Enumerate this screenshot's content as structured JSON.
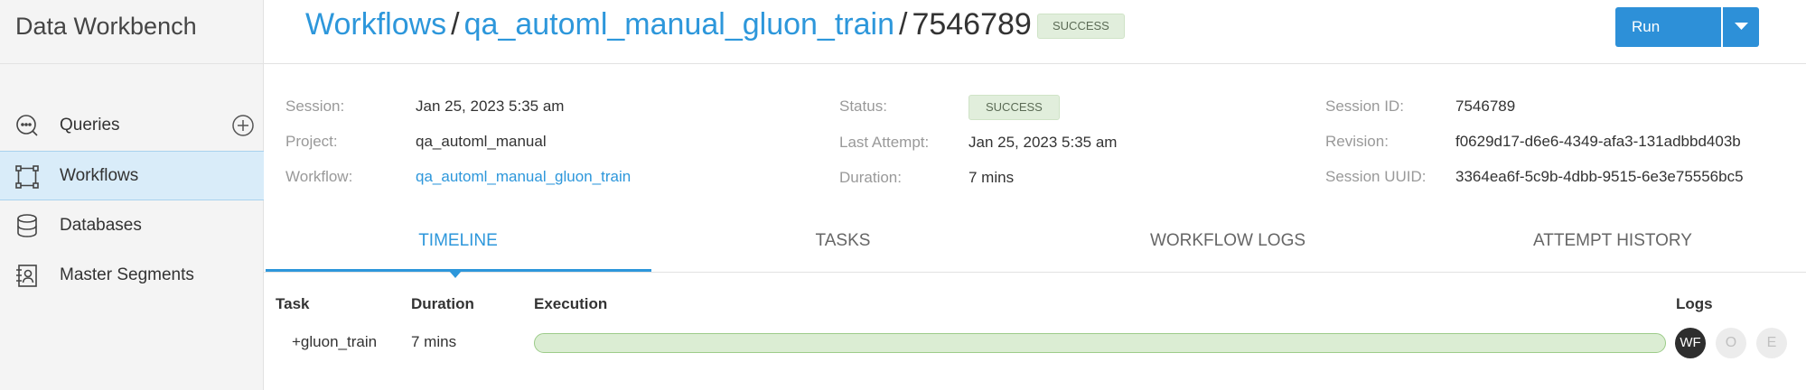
{
  "app": {
    "title": "Data Workbench"
  },
  "sidebar": {
    "items": [
      {
        "label": "Queries",
        "icon": "chat-icon",
        "active": false
      },
      {
        "label": "Workflows",
        "icon": "workflow-icon",
        "active": true
      },
      {
        "label": "Databases",
        "icon": "database-icon",
        "active": false
      },
      {
        "label": "Master Segments",
        "icon": "segment-icon",
        "active": false
      }
    ]
  },
  "header": {
    "breadcrumb": [
      "Workflows",
      "qa_automl_manual_gluon_train",
      "7546789"
    ],
    "separator": "/",
    "badge": "SUCCESS",
    "run_label": "Run"
  },
  "details": {
    "session_label": "Session:",
    "session_value": "Jan 25, 2023 5:35 am",
    "project_label": "Project:",
    "project_value": "qa_automl_manual",
    "workflow_label": "Workflow:",
    "workflow_value": "qa_automl_manual_gluon_train",
    "status_label": "Status:",
    "status_value": "SUCCESS",
    "last_attempt_label": "Last Attempt:",
    "last_attempt_value": "Jan 25, 2023 5:35 am",
    "duration_label": "Duration:",
    "duration_value": "7 mins",
    "session_id_label": "Session ID:",
    "session_id_value": "7546789",
    "revision_label": "Revision:",
    "revision_value": "f0629d17-d6e6-4349-afa3-131adbbd403b",
    "session_uuid_label": "Session UUID:",
    "session_uuid_value": "3364ea6f-5c9b-4dbb-9515-6e3e75556bc5"
  },
  "tabs": [
    {
      "label": "TIMELINE",
      "active": true
    },
    {
      "label": "TASKS",
      "active": false
    },
    {
      "label": "WORKFLOW LOGS",
      "active": false
    },
    {
      "label": "ATTEMPT HISTORY",
      "active": false
    }
  ],
  "timeline": {
    "columns": [
      "Task",
      "Duration",
      "Execution",
      "Logs"
    ],
    "rows": [
      {
        "task": "+gluon_train",
        "duration": "7 mins",
        "logs": [
          "WF",
          "O",
          "E"
        ]
      }
    ]
  },
  "colors": {
    "accent": "#2d97db",
    "success_bg": "#e1eedc",
    "bar": "#dbedd3"
  }
}
